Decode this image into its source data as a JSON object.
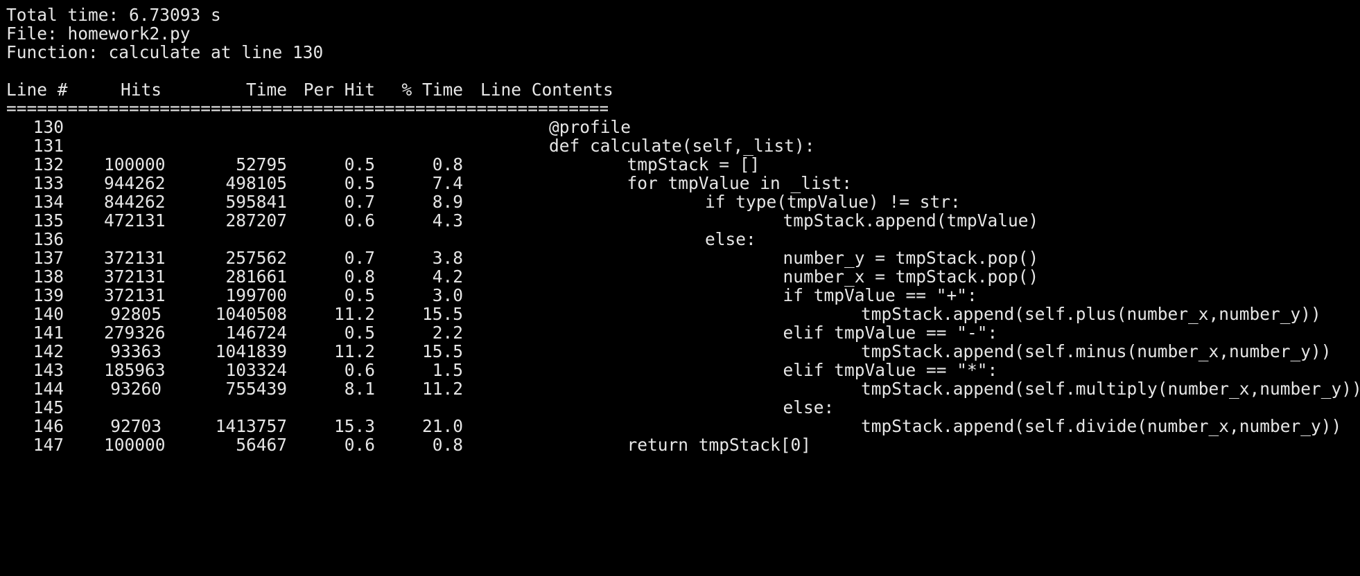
{
  "header": {
    "total_time": "Total time: 6.73093 s",
    "file": "File: homework2.py",
    "function": "Function: calculate at line 130"
  },
  "columns": {
    "line": "Line #",
    "hits": "Hits",
    "time": "Time",
    "per_hit": "Per Hit",
    "pct_time": "% Time",
    "contents": "Line Contents"
  },
  "separator": "==============================================================",
  "rows": [
    {
      "line": "130",
      "hits": "",
      "time": "",
      "per_hit": "",
      "pct": "",
      "code": "@profile",
      "indent": 0
    },
    {
      "line": "131",
      "hits": "",
      "time": "",
      "per_hit": "",
      "pct": "",
      "code": "def calculate(self,_list):",
      "indent": 0
    },
    {
      "line": "132",
      "hits": "100000",
      "time": "52795",
      "per_hit": "0.5",
      "pct": "0.8",
      "code": "tmpStack = []",
      "indent": 1
    },
    {
      "line": "133",
      "hits": "944262",
      "time": "498105",
      "per_hit": "0.5",
      "pct": "7.4",
      "code": "for tmpValue in _list:",
      "indent": 1
    },
    {
      "line": "134",
      "hits": "844262",
      "time": "595841",
      "per_hit": "0.7",
      "pct": "8.9",
      "code": "if type(tmpValue) != str:",
      "indent": 2
    },
    {
      "line": "135",
      "hits": "472131",
      "time": "287207",
      "per_hit": "0.6",
      "pct": "4.3",
      "code": "tmpStack.append(tmpValue)",
      "indent": 3
    },
    {
      "line": "136",
      "hits": "",
      "time": "",
      "per_hit": "",
      "pct": "",
      "code": "else:",
      "indent": 2
    },
    {
      "line": "137",
      "hits": "372131",
      "time": "257562",
      "per_hit": "0.7",
      "pct": "3.8",
      "code": "number_y = tmpStack.pop()",
      "indent": 3
    },
    {
      "line": "138",
      "hits": "372131",
      "time": "281661",
      "per_hit": "0.8",
      "pct": "4.2",
      "code": "number_x = tmpStack.pop()",
      "indent": 3
    },
    {
      "line": "139",
      "hits": "372131",
      "time": "199700",
      "per_hit": "0.5",
      "pct": "3.0",
      "code": "if tmpValue == \"+\":",
      "indent": 3
    },
    {
      "line": "140",
      "hits": "92805",
      "time": "1040508",
      "per_hit": "11.2",
      "pct": "15.5",
      "code": "tmpStack.append(self.plus(number_x,number_y))",
      "indent": 4
    },
    {
      "line": "141",
      "hits": "279326",
      "time": "146724",
      "per_hit": "0.5",
      "pct": "2.2",
      "code": "elif tmpValue == \"-\":",
      "indent": 3
    },
    {
      "line": "142",
      "hits": "93363",
      "time": "1041839",
      "per_hit": "11.2",
      "pct": "15.5",
      "code": "tmpStack.append(self.minus(number_x,number_y))",
      "indent": 4
    },
    {
      "line": "143",
      "hits": "185963",
      "time": "103324",
      "per_hit": "0.6",
      "pct": "1.5",
      "code": "elif tmpValue == \"*\":",
      "indent": 3
    },
    {
      "line": "144",
      "hits": "93260",
      "time": "755439",
      "per_hit": "8.1",
      "pct": "11.2",
      "code": "tmpStack.append(self.multiply(number_x,number_y))",
      "indent": 4
    },
    {
      "line": "145",
      "hits": "",
      "time": "",
      "per_hit": "",
      "pct": "",
      "code": "else:",
      "indent": 3
    },
    {
      "line": "146",
      "hits": "92703",
      "time": "1413757",
      "per_hit": "15.3",
      "pct": "21.0",
      "code": "tmpStack.append(self.divide(number_x,number_y))",
      "indent": 4
    },
    {
      "line": "147",
      "hits": "100000",
      "time": "56467",
      "per_hit": "0.6",
      "pct": "0.8",
      "code": "return tmpStack[0]",
      "indent": 1
    }
  ]
}
